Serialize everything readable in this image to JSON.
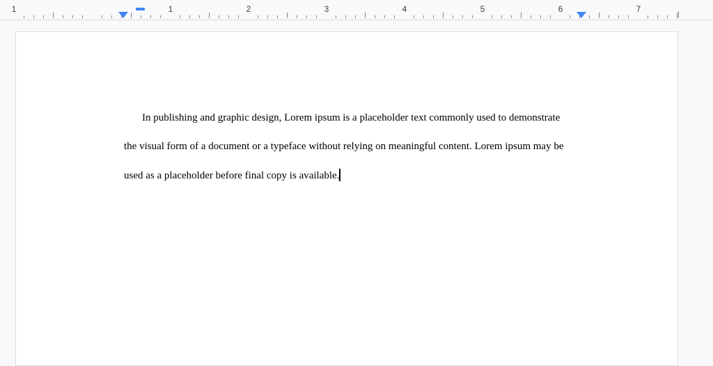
{
  "ruler": {
    "numbers": [
      "1",
      "1",
      "2",
      "3",
      "4",
      "5",
      "6",
      "7"
    ]
  },
  "document": {
    "lines": [
      "In publishing and graphic design, Lorem ipsum is a placeholder text commonly used to demonstrate",
      "the visual form of a document or a typeface without relying on meaningful content. Lorem ipsum may be",
      "used as a placeholder before final copy is available."
    ]
  },
  "colors": {
    "accent": "#4285f4",
    "page": "#ffffff",
    "background": "#f8f9fa"
  }
}
